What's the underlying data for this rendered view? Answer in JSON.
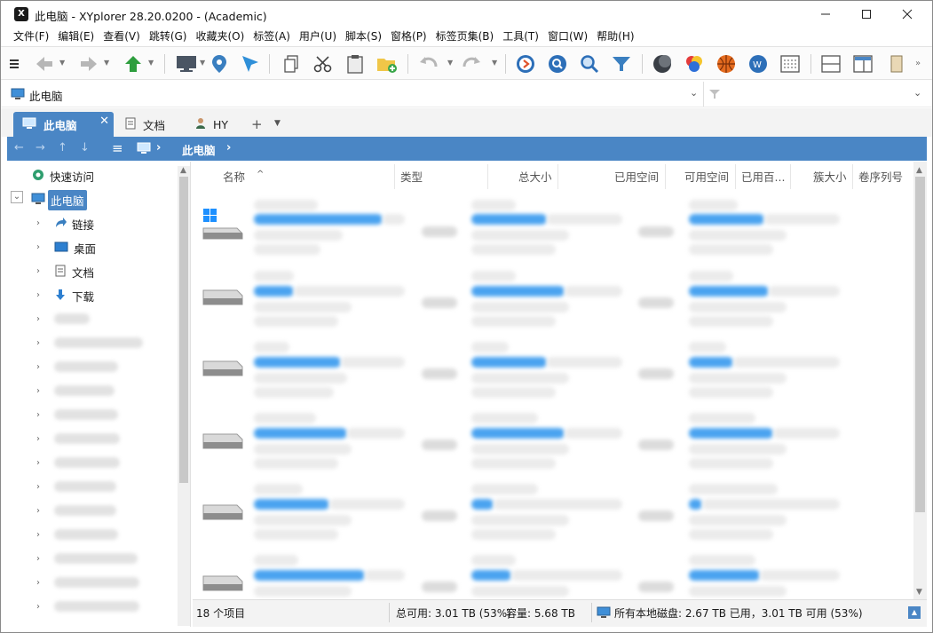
{
  "window": {
    "title": "此电脑 - XYplorer 28.20.0200 - (Academic)",
    "app_icon_text": "X"
  },
  "menu": [
    "文件(F)",
    "编辑(E)",
    "查看(V)",
    "跳转(G)",
    "收藏夹(O)",
    "标签(A)",
    "用户(U)",
    "脚本(S)",
    "窗格(P)",
    "标签页集(B)",
    "工具(T)",
    "窗口(W)",
    "帮助(H)"
  ],
  "address": {
    "value": "此电脑"
  },
  "tabs": [
    {
      "label": "此电脑",
      "active": true,
      "icon": "computer-icon"
    },
    {
      "label": "文档",
      "active": false,
      "icon": "document-icon"
    },
    {
      "label": "HY",
      "active": false,
      "icon": "user-icon"
    }
  ],
  "breadcrumb": {
    "label": "此电脑"
  },
  "tree": {
    "quick_access": "快速访问",
    "this_pc": "此电脑",
    "children": [
      "链接",
      "桌面",
      "文档",
      "下载"
    ]
  },
  "columns": [
    "名称",
    "类型",
    "总大小",
    "已用空间",
    "可用空间",
    "已用百...",
    "簇大小",
    "卷序列号"
  ],
  "status": {
    "item_count": "18 个项目",
    "free_total": "总可用: 3.01 TB (53%)",
    "capacity": "容量: 5.68 TB",
    "all_disks": "所有本地磁盘: 2.67 TB 已用，3.01 TB 可用 (53%)"
  },
  "colors": {
    "accent": "#4a86c5",
    "usage_bar": "#4aa3f0"
  }
}
